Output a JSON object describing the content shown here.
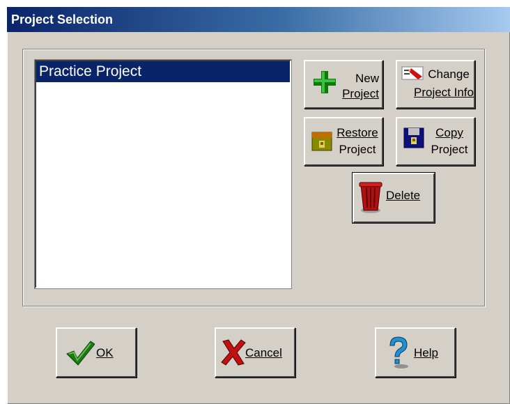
{
  "window": {
    "title": "Project Selection"
  },
  "projects": {
    "items": [
      "Practice Project"
    ],
    "selected_index": 0
  },
  "actions": {
    "new": {
      "line1": "New",
      "line2": "Project"
    },
    "change": {
      "line1": "Change",
      "line2": "Project Info"
    },
    "restore": {
      "line1": "Restore",
      "line2": "Project"
    },
    "copy": {
      "line1": "Copy",
      "line2": "Project"
    },
    "delete": {
      "label": "Delete"
    }
  },
  "dialog_buttons": {
    "ok": "OK",
    "cancel": "Cancel",
    "help": "Help"
  },
  "colors": {
    "title_gradient_start": "#0a246a",
    "title_gradient_end": "#a6caf0",
    "selection": "#0a246a",
    "face": "#d4d0c8"
  },
  "icons": {
    "new": "plus-icon",
    "change": "edit-info-icon",
    "restore": "restore-folder-icon",
    "copy": "copy-disk-icon",
    "delete": "trash-can-icon",
    "ok": "checkmark-icon",
    "cancel": "x-mark-icon",
    "help": "question-mark-icon"
  }
}
